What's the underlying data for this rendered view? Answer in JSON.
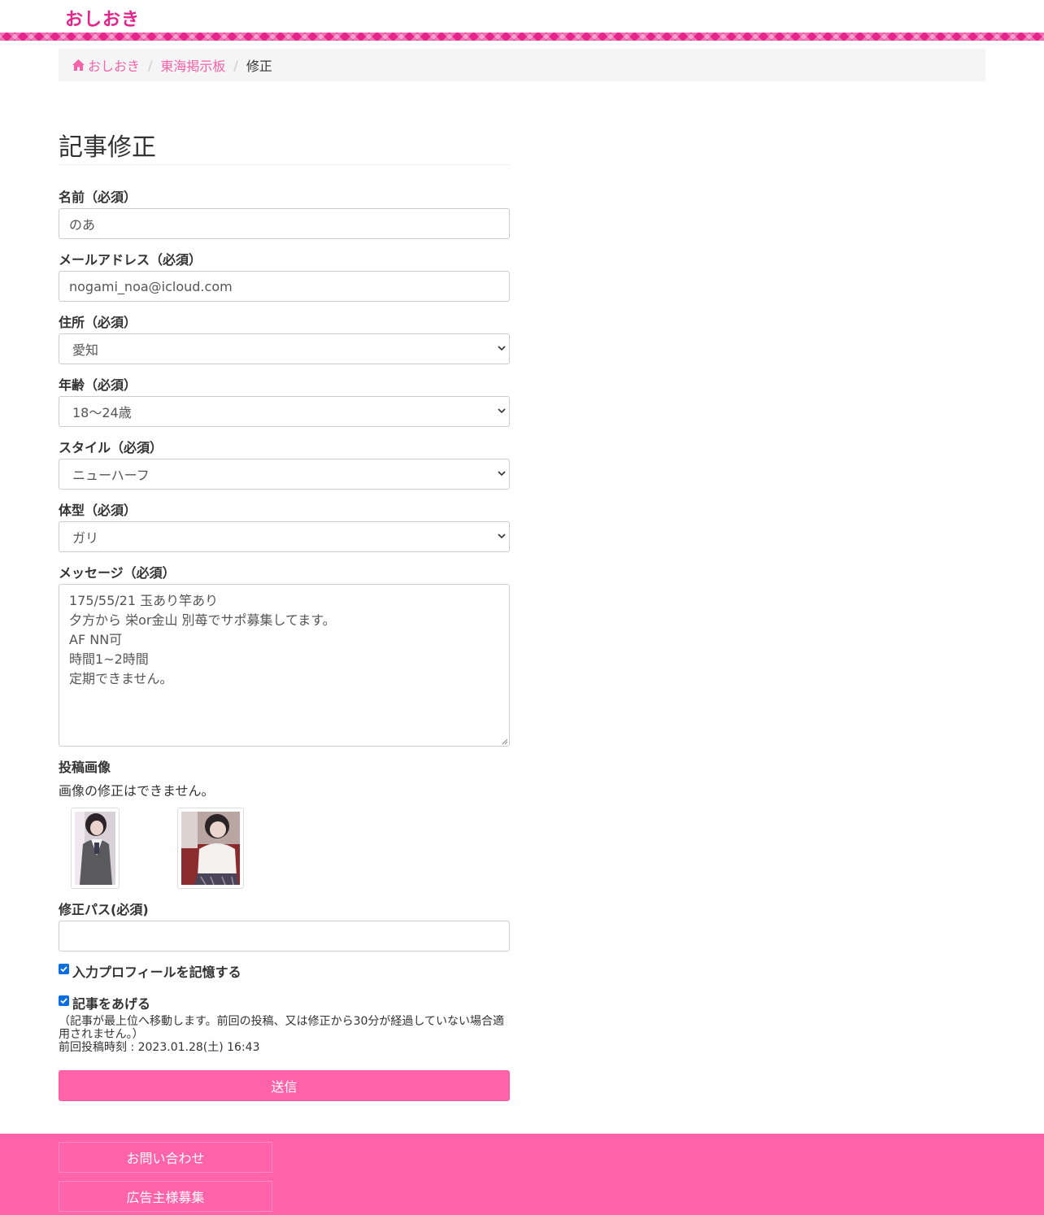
{
  "header": {
    "logo": "おしおき"
  },
  "breadcrumb": {
    "home": "おしおき",
    "board": "東海掲示板",
    "current": "修正",
    "separator": "/"
  },
  "form": {
    "title": "記事修正",
    "name": {
      "label": "名前（必須）",
      "value": "のあ"
    },
    "email": {
      "label": "メールアドレス（必須）",
      "value": "nogami_noa@icloud.com"
    },
    "address": {
      "label": "住所（必須）",
      "value": "愛知"
    },
    "age": {
      "label": "年齢（必須）",
      "value": "18〜24歳"
    },
    "style": {
      "label": "スタイル（必須）",
      "value": "ニューハーフ"
    },
    "body_type": {
      "label": "体型（必須）",
      "value": "ガリ"
    },
    "message": {
      "label": "メッセージ（必須）",
      "value": "175/55/21 玉あり竿あり\n夕方から 栄or金山 別苺でサポ募集してます。\nAF NN可\n時間1~2時間\n定期できません。"
    },
    "images": {
      "label": "投稿画像",
      "note": "画像の修正はできません。"
    },
    "password": {
      "label": "修正パス(必須)",
      "value": ""
    },
    "remember": {
      "label": "入力プロフィールを記憶する",
      "checked": true
    },
    "bump": {
      "label": "記事をあげる",
      "checked": true,
      "note": "（記事が最上位へ移動します。前回の投稿、又は修正から30分が経過していない場合適用されません。）",
      "last_post": "前回投稿時刻 : 2023.01.28(土) 16:43"
    },
    "submit_label": "送信"
  },
  "footer": {
    "contact": "お問い合わせ",
    "advertisers": "広告主様募集"
  },
  "colors": {
    "brand": "#e5258c",
    "accent": "#ff64aa",
    "link": "#f462a9"
  },
  "icons": {
    "home": "home-icon",
    "select": "chevron-down-icon",
    "check": "check-icon"
  }
}
